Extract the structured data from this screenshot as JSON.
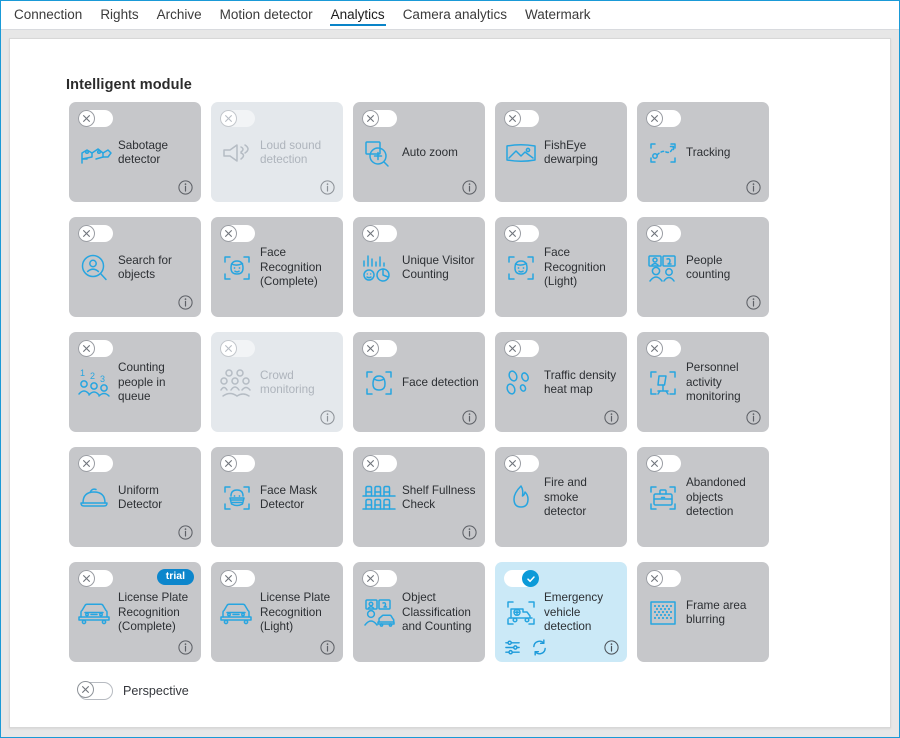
{
  "window": {
    "border_color": "#1a9ad7",
    "accent_color": "#0a84c8"
  },
  "tabs": [
    {
      "label": "Connection",
      "active": false
    },
    {
      "label": "Rights",
      "active": false
    },
    {
      "label": "Archive",
      "active": false
    },
    {
      "label": "Motion detector",
      "active": false
    },
    {
      "label": "Analytics",
      "active": true
    },
    {
      "label": "Camera analytics",
      "active": false
    },
    {
      "label": "Watermark",
      "active": false
    }
  ],
  "section": {
    "title": "Intelligent module"
  },
  "modules": [
    {
      "label": "Sabotage detector",
      "icon": "sabotage-icon",
      "state": "off",
      "enabled": true,
      "info": true,
      "trial": false
    },
    {
      "label": "Loud sound detection",
      "icon": "loud-sound-icon",
      "state": "off",
      "enabled": false,
      "info": true,
      "trial": false
    },
    {
      "label": "Auto zoom",
      "icon": "auto-zoom-icon",
      "state": "off",
      "enabled": true,
      "info": true,
      "trial": false
    },
    {
      "label": "FishEye dewarping",
      "icon": "fisheye-icon",
      "state": "off",
      "enabled": true,
      "info": false,
      "trial": false
    },
    {
      "label": "Tracking",
      "icon": "tracking-icon",
      "state": "off",
      "enabled": true,
      "info": true,
      "trial": false
    },
    {
      "label": "Search for objects",
      "icon": "search-objects-icon",
      "state": "off",
      "enabled": true,
      "info": true,
      "trial": false
    },
    {
      "label": "Face Recognition (Complete)",
      "icon": "face-recognition-icon",
      "state": "off",
      "enabled": true,
      "info": false,
      "trial": false
    },
    {
      "label": "Unique Visitor Counting",
      "icon": "unique-visitor-icon",
      "state": "off",
      "enabled": true,
      "info": false,
      "trial": false
    },
    {
      "label": "Face Recognition (Light)",
      "icon": "face-recognition-icon",
      "state": "off",
      "enabled": true,
      "info": false,
      "trial": false
    },
    {
      "label": "People counting",
      "icon": "people-counting-icon",
      "state": "off",
      "enabled": true,
      "info": true,
      "trial": false
    },
    {
      "label": "Counting people in queue",
      "icon": "queue-counting-icon",
      "state": "off",
      "enabled": true,
      "info": false,
      "trial": false
    },
    {
      "label": "Crowd monitoring",
      "icon": "crowd-icon",
      "state": "off",
      "enabled": false,
      "info": true,
      "trial": false
    },
    {
      "label": "Face detection",
      "icon": "face-detection-icon",
      "state": "off",
      "enabled": true,
      "info": true,
      "trial": false
    },
    {
      "label": "Traffic density heat map",
      "icon": "heatmap-icon",
      "state": "off",
      "enabled": true,
      "info": true,
      "trial": false
    },
    {
      "label": "Personnel activity monitoring",
      "icon": "personnel-activity-icon",
      "state": "off",
      "enabled": true,
      "info": true,
      "trial": false
    },
    {
      "label": "Uniform Detector",
      "icon": "helmet-icon",
      "state": "off",
      "enabled": true,
      "info": true,
      "trial": false
    },
    {
      "label": "Face Mask Detector",
      "icon": "face-mask-icon",
      "state": "off",
      "enabled": true,
      "info": false,
      "trial": false
    },
    {
      "label": "Shelf Fullness Check",
      "icon": "shelf-icon",
      "state": "off",
      "enabled": true,
      "info": true,
      "trial": false
    },
    {
      "label": "Fire and smoke detector",
      "icon": "flame-icon",
      "state": "off",
      "enabled": true,
      "info": false,
      "trial": false
    },
    {
      "label": "Abandoned objects detection",
      "icon": "abandoned-object-icon",
      "state": "off",
      "enabled": true,
      "info": false,
      "trial": false
    },
    {
      "label": "License Plate Recognition (Complete)",
      "icon": "license-plate-icon",
      "state": "off",
      "enabled": true,
      "info": true,
      "trial": true,
      "trial_label": "trial"
    },
    {
      "label": "License Plate Recognition (Light)",
      "icon": "license-plate-icon",
      "state": "off",
      "enabled": true,
      "info": true,
      "trial": false
    },
    {
      "label": "Object Classification and Counting",
      "icon": "object-classify-icon",
      "state": "off",
      "enabled": true,
      "info": false,
      "trial": false
    },
    {
      "label": "Emergency vehicle detection",
      "icon": "ambulance-icon",
      "state": "on",
      "enabled": true,
      "info": true,
      "trial": false,
      "tools": [
        "settings-sliders-icon",
        "refresh-icon"
      ]
    },
    {
      "label": "Frame area blurring",
      "icon": "frame-blur-icon",
      "state": "off",
      "enabled": true,
      "info": false,
      "trial": false
    }
  ],
  "perspective": {
    "label": "Perspective",
    "state": "off"
  }
}
